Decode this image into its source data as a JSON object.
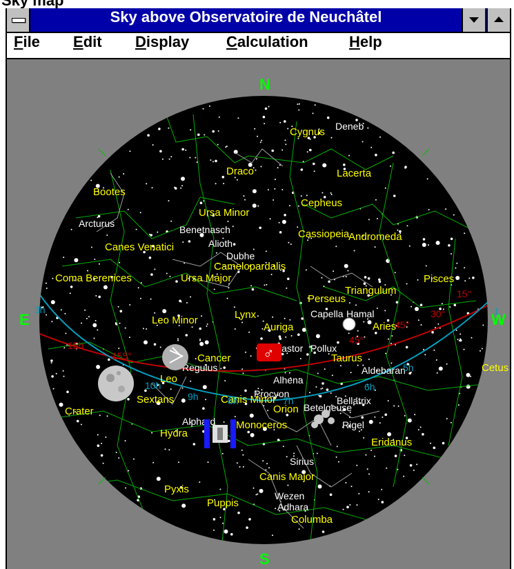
{
  "window": {
    "title": "Sky above Observatoire de Neuchâtel",
    "top_strip_text": "Sky map"
  },
  "menu": [
    {
      "key": "F",
      "rest": "ile"
    },
    {
      "key": "E",
      "rest": "dit"
    },
    {
      "key": "D",
      "rest": "isplay"
    },
    {
      "key": "C",
      "rest": "alculation"
    },
    {
      "key": "H",
      "rest": "elp"
    }
  ],
  "compass": {
    "north": "N",
    "south": "S",
    "east": "E",
    "west": "W"
  },
  "constellations": [
    "Cygnus",
    "Draco",
    "Lacerta",
    "Bootes",
    "Cepheus",
    "Ursa Minor",
    "Cassiopeia",
    "Andromeda",
    "Canes Venatici",
    "Camelopardalis",
    "Coma Berenices",
    "Ursa Major",
    "Pisces",
    "Triangulum",
    "Perseus",
    "Leo Minor",
    "Lynx",
    "Auriga",
    "Aries",
    "Cancer",
    "Taurus",
    "Leo",
    "Cetus",
    "Sextans",
    "Canis Minor",
    "Orion",
    "Crater",
    "Hydra",
    "Monoceros",
    "Eridanus",
    "Canis Major",
    "Pyxis",
    "Puppis",
    "Columba"
  ],
  "stars": [
    "Deneb",
    "Arcturus",
    "Benetnasch",
    "Alioth",
    "Dubhe",
    "Capella",
    "Hamal",
    "Castor",
    "Pollux",
    "Regulus",
    "Alhena",
    "Procyon",
    "Aldebaran",
    "Betelgeuse",
    "Bellatrix",
    "Rigel",
    "Sirius",
    "Wezen",
    "Adhara",
    "Alphard"
  ],
  "grid_labels": [
    "3h",
    "15h",
    "155°",
    "10h",
    "9h",
    "8h",
    "7h",
    "6h",
    "5h",
    "1",
    "15°",
    "30°",
    "45°",
    "45°"
  ],
  "colors": {
    "sky": "#000000",
    "background": "#808080",
    "lines": "#00c000",
    "constellation_text": "#ffff00",
    "star_text": "#ffffff",
    "compass": "#00ff00",
    "ecliptic": "#c00000",
    "equator": "#00a0c0",
    "titlebar": "#0000a8"
  },
  "symbols": {
    "mars": "♂",
    "moon": "moon-icon",
    "comet": "comet-icon",
    "satellite": "satellite-icon"
  }
}
